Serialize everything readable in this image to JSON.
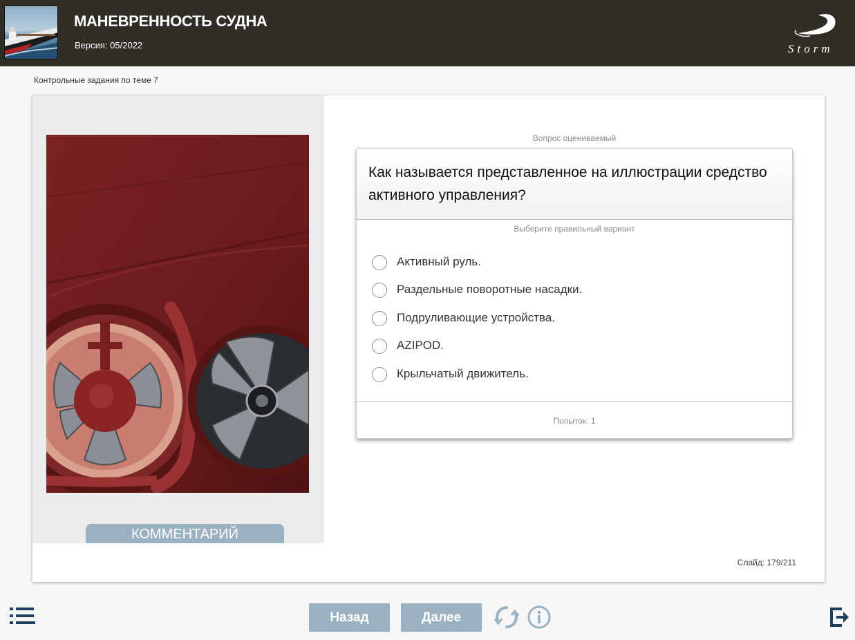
{
  "header": {
    "title": "МАНЕВРЕННОСТЬ СУДНА",
    "version": "Версия: 05/2022",
    "logo_text": "Storm"
  },
  "breadcrumb": "Контрольные задания по теме 7",
  "left_panel": {
    "image_icon": "bow-thruster-photo",
    "comment_label": "КОММЕНТАРИЙ"
  },
  "question": {
    "graded_label": "Вопрос оцениваемый",
    "text": "Как называется представленное на иллюстрации средство активного управления?",
    "hint": "Выберите правильный вариант",
    "options": [
      {
        "label": "Активный руль."
      },
      {
        "label": "Раздельные поворотные насадки."
      },
      {
        "label": "Подруливающие устройства."
      },
      {
        "label": "AZIPOD."
      },
      {
        "label": "Крыльчатый движитель."
      }
    ],
    "attempts": "Попыток: 1"
  },
  "slide_counter": "Слайд: 179/211",
  "footer": {
    "back_label": "Назад",
    "next_label": "Далее",
    "icons": [
      "menu-icon",
      "reload-icon",
      "info-icon",
      "exit-icon"
    ]
  },
  "colors": {
    "header_bg": "#2f2d25",
    "button_bg": "#9ab1c1",
    "icon_color": "#1f3f5f",
    "page_bg": "#f6f6f6"
  }
}
